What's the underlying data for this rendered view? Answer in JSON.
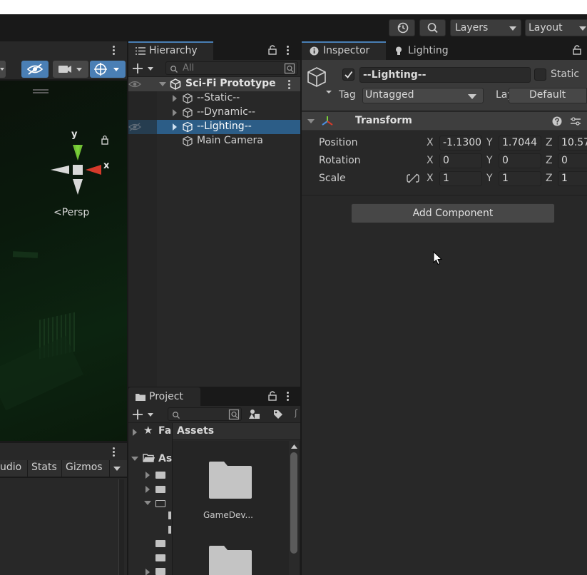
{
  "toolbar": {
    "layers_label": "Layers",
    "layout_label": "Layout"
  },
  "scene": {
    "gizmo_y": "y",
    "gizmo_x": "x",
    "persp_label": "Persp"
  },
  "game": {
    "buttons": [
      "udio",
      "Stats",
      "Gizmos"
    ]
  },
  "hierarchy": {
    "tab_label": "Hierarchy",
    "search_placeholder": "All",
    "scene_name": "Sci-Fi Prototype",
    "items": [
      "--Static--",
      "--Dynamic--",
      "--Lighting--",
      "Main Camera"
    ]
  },
  "project": {
    "tab_label": "Project",
    "tree": [
      "Fa",
      "As"
    ],
    "assets_header": "Assets",
    "folder_name": "GameDev..."
  },
  "inspector": {
    "tab_label": "Inspector",
    "lighting_tab_label": "Lighting",
    "object_name": "--Lighting--",
    "static_label": "Static",
    "tag_label": "Tag",
    "tag_value": "Untagged",
    "layer_label": "Layer",
    "layer_value": "Default",
    "component_title": "Transform",
    "position_label": "Position",
    "rotation_label": "Rotation",
    "scale_label": "Scale",
    "axis_x": "X",
    "axis_y": "Y",
    "axis_z": "Z",
    "position": {
      "x": "-1.1300",
      "y": "1.7044",
      "z": "10.57"
    },
    "rotation": {
      "x": "0",
      "y": "0",
      "z": "0"
    },
    "scale": {
      "x": "1",
      "y": "1",
      "z": "1"
    },
    "add_component_label": "Add Component"
  },
  "colors": {
    "selection": "#2c5d87",
    "accent_blue": "#4a7fb5",
    "gizmo_x": "#d63a2b",
    "gizmo_y": "#7bd13a"
  }
}
